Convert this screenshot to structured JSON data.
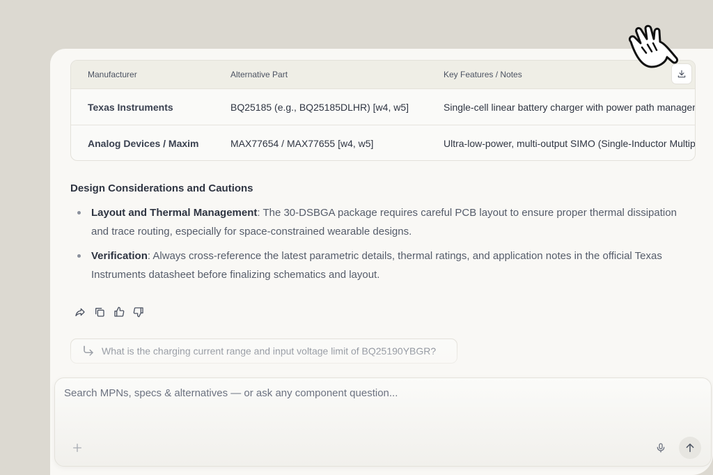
{
  "table": {
    "headers": [
      "Manufacturer",
      "Alternative Part",
      "Key Features / Notes"
    ],
    "rows": [
      [
        "Texas Instruments",
        "BQ25185 (e.g., BQ25185DLHR) [w4, w5]",
        "Single-cell linear battery charger with power path management"
      ],
      [
        "Analog Devices / Maxim",
        "MAX77654 / MAX77655 [w4, w5]",
        "Ultra-low-power, multi-output SIMO (Single-Inductor Multiple-Output)"
      ]
    ],
    "download_icon": "download-icon"
  },
  "section": {
    "title": "Design Considerations and Cautions",
    "bullets": [
      {
        "bold": "Layout and Thermal Management",
        "text": ": The 30-DSBGA package requires careful PCB layout to ensure proper thermal dissipation and trace routing, especially for space-constrained wearable designs."
      },
      {
        "bold": "Verification",
        "text": ": Always cross-reference the latest parametric details, thermal ratings, and application notes in the official Texas Instruments datasheet before finalizing schematics and layout."
      }
    ]
  },
  "actions": [
    "share-icon",
    "copy-icon",
    "thumbs-up-icon",
    "thumbs-down-icon"
  ],
  "suggestion": {
    "text": "What is the charging current range and input voltage limit of BQ25190YBGR?"
  },
  "composer": {
    "placeholder": "Search MPNs, specs & alternatives — or ask any component question...",
    "value": ""
  },
  "colors": {
    "background": "#dcd9d1",
    "panel": "#f9f8f5",
    "table_header": "#efeee6",
    "text": "#2f3542",
    "muted": "#555c6a"
  }
}
